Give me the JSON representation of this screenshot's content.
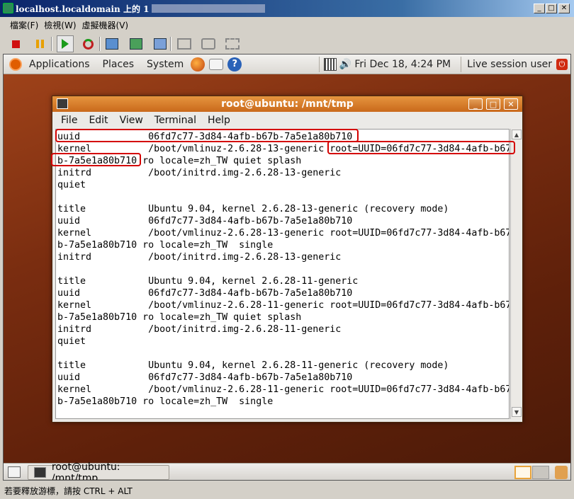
{
  "vm": {
    "title": "localhost.localdomain 上的 1",
    "menu": [
      "檔案(F)",
      "檢視(W)",
      "虛擬機器(V)"
    ],
    "status": "若要釋放游標，請按 CTRL + ALT"
  },
  "colors": {
    "highlight": "#d40000",
    "terminal_titlebar": "#d97a2a",
    "guest_background": "#7a2d10"
  },
  "panel": {
    "menus": [
      "Applications",
      "Places",
      "System"
    ],
    "datetime": "Fri Dec 18,  4:24 PM",
    "user": "Live session user",
    "taskbar_item": "root@ubuntu: /mnt/tmp"
  },
  "terminal": {
    "title": "root@ubuntu: /mnt/tmp",
    "menu": [
      "File",
      "Edit",
      "View",
      "Terminal",
      "Help"
    ],
    "lines": [
      "uuid            06fd7c77-3d84-4afb-b67b-7a5e1a80b710",
      "kernel          /boot/vmlinuz-2.6.28-13-generic root=UUID=06fd7c77-3d84-4afb-b67",
      "b-7a5e1a80b710 ro locale=zh_TW quiet splash",
      "initrd          /boot/initrd.img-2.6.28-13-generic",
      "quiet",
      "",
      "title           Ubuntu 9.04, kernel 2.6.28-13-generic (recovery mode)",
      "uuid            06fd7c77-3d84-4afb-b67b-7a5e1a80b710",
      "kernel          /boot/vmlinuz-2.6.28-13-generic root=UUID=06fd7c77-3d84-4afb-b67",
      "b-7a5e1a80b710 ro locale=zh_TW  single",
      "initrd          /boot/initrd.img-2.6.28-13-generic",
      "",
      "title           Ubuntu 9.04, kernel 2.6.28-11-generic",
      "uuid            06fd7c77-3d84-4afb-b67b-7a5e1a80b710",
      "kernel          /boot/vmlinuz-2.6.28-11-generic root=UUID=06fd7c77-3d84-4afb-b67",
      "b-7a5e1a80b710 ro locale=zh_TW quiet splash",
      "initrd          /boot/initrd.img-2.6.28-11-generic",
      "quiet",
      "",
      "title           Ubuntu 9.04, kernel 2.6.28-11-generic (recovery mode)",
      "uuid            06fd7c77-3d84-4afb-b67b-7a5e1a80b710",
      "kernel          /boot/vmlinuz-2.6.28-11-generic root=UUID=06fd7c77-3d84-4afb-b67",
      "b-7a5e1a80b710 ro locale=zh_TW  single"
    ]
  }
}
